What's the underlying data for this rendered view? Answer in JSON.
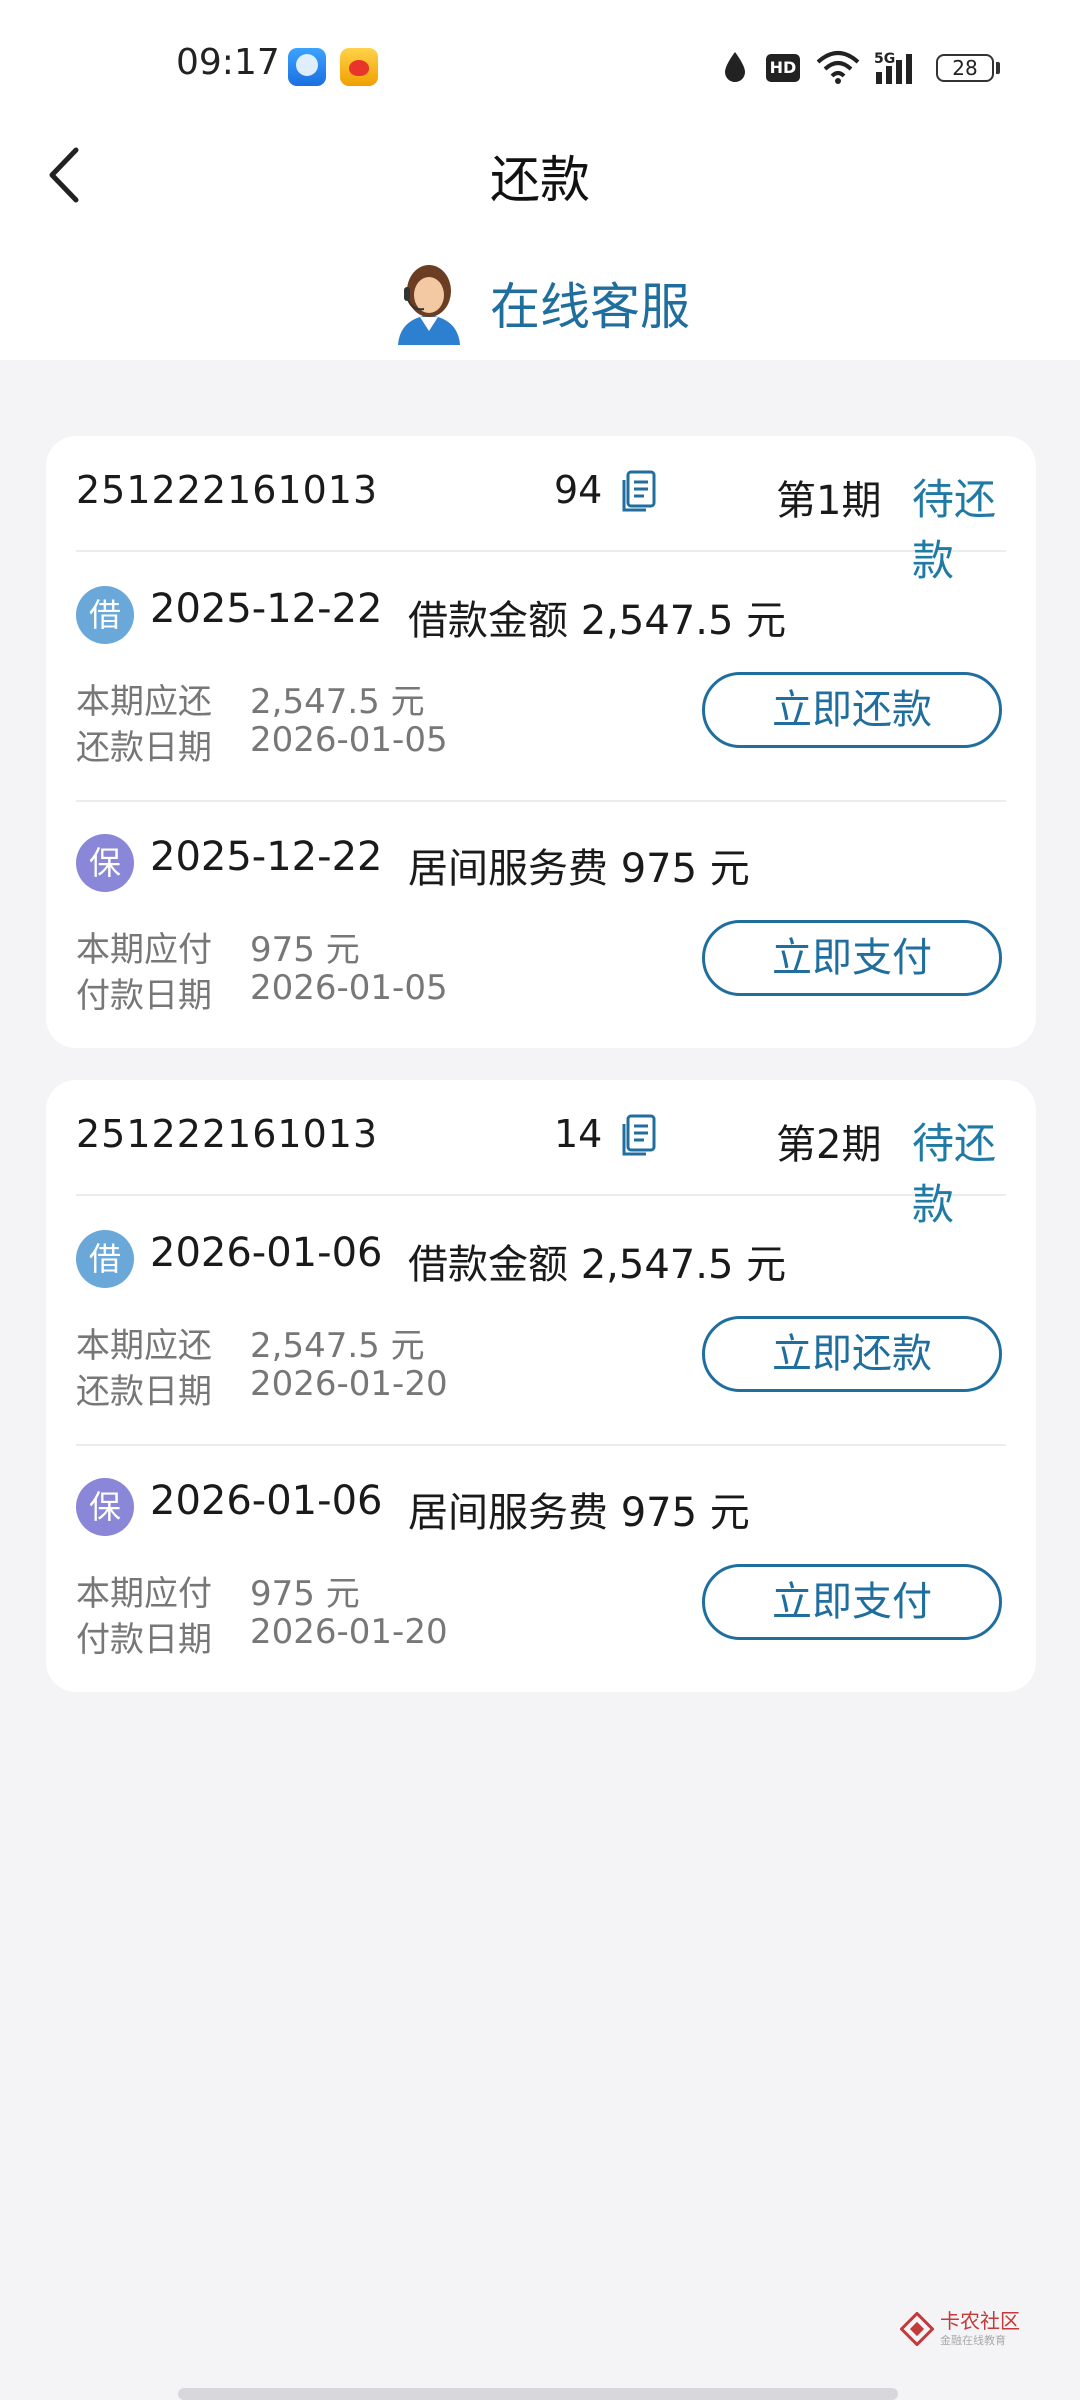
{
  "status_bar": {
    "time": "09:17",
    "hd": "HD",
    "network": "5G",
    "battery": "28"
  },
  "nav": {
    "title": "还款",
    "back_icon": "chevron-left-icon"
  },
  "service": {
    "label": "在线客服",
    "icon": "customer-service-avatar-icon"
  },
  "colors": {
    "accent": "#1f6e9e",
    "status": "#1f7aa5",
    "loan_badge": "#6aa8da",
    "guarantee_badge": "#8a86d8",
    "background": "#f4f4f6"
  },
  "cards": [
    {
      "order_no": "251222161013",
      "order_no_tail": "94",
      "period": "第1期",
      "status": "待还款",
      "rows": [
        {
          "badge": "借",
          "date": "2025-12-22",
          "title": "借款金额 2,547.5 元",
          "line1_label": "本期应还",
          "line1_value": "2,547.5 元",
          "line2_label": "还款日期",
          "line2_value": "2026-01-05",
          "button": "立即还款"
        },
        {
          "badge": "保",
          "date": "2025-12-22",
          "title": "居间服务费 975 元",
          "line1_label": "本期应付",
          "line1_value": "975 元",
          "line2_label": "付款日期",
          "line2_value": "2026-01-05",
          "button": "立即支付"
        }
      ]
    },
    {
      "order_no": "251222161013",
      "order_no_tail": "14",
      "period": "第2期",
      "status": "待还款",
      "rows": [
        {
          "badge": "借",
          "date": "2026-01-06",
          "title": "借款金额 2,547.5 元",
          "line1_label": "本期应还",
          "line1_value": "2,547.5 元",
          "line2_label": "还款日期",
          "line2_value": "2026-01-20",
          "button": "立即还款"
        },
        {
          "badge": "保",
          "date": "2026-01-06",
          "title": "居间服务费 975 元",
          "line1_label": "本期应付",
          "line1_value": "975 元",
          "line2_label": "付款日期",
          "line2_value": "2026-01-20",
          "button": "立即支付"
        }
      ]
    }
  ],
  "watermark": {
    "name": "卡农社区",
    "tagline": "金融在线教育"
  }
}
